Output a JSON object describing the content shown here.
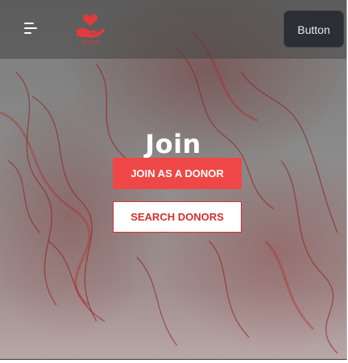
{
  "header": {
    "menu_icon": "hamburger-menu-icon",
    "logo_icon": "hand-heart-logo-icon",
    "logo_text": "ECOOS",
    "button_label": "Button"
  },
  "hero": {
    "title": "Join",
    "primary_button": "JOIN AS A DONOR",
    "secondary_button": "SEARCH DONORS"
  },
  "colors": {
    "accent": "#ef4747",
    "header_button_bg": "#2b2f35"
  }
}
